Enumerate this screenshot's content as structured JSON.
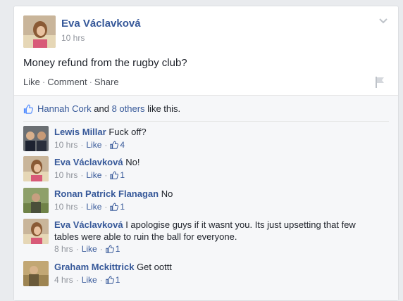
{
  "post": {
    "author": "Eva Václavková",
    "time": "10 hrs",
    "text": "Money refund from the rugby club?",
    "actions": {
      "like": "Like",
      "comment": "Comment",
      "share": "Share",
      "separator": "·"
    }
  },
  "likes": {
    "first_name": "Hannah Cork",
    "and_text": "and",
    "others": "8 others",
    "suffix": "like this."
  },
  "comments": [
    {
      "name": "Lewis Millar",
      "text": "Fuck off?",
      "time": "10 hrs",
      "like_label": "Like",
      "like_count": "4"
    },
    {
      "name": "Eva Václavková",
      "text": "No!",
      "time": "10 hrs",
      "like_label": "Like",
      "like_count": "1"
    },
    {
      "name": "Ronan Patrick Flanagan",
      "text": "No",
      "time": "10 hrs",
      "like_label": "Like",
      "like_count": "1"
    },
    {
      "name": "Eva Václavková",
      "text": "I apologise guys if it wasnt you. Its just upsetting that few tables were able to ruin the ball for everyone.",
      "time": "8 hrs",
      "like_label": "Like",
      "like_count": "1"
    },
    {
      "name": "Graham Mckittrick",
      "text": "Get oottt",
      "time": "4 hrs",
      "like_label": "Like",
      "like_count": "1"
    }
  ],
  "colors": {
    "link_blue": "#365899",
    "muted": "#90949c",
    "background": "#e9ebee"
  }
}
